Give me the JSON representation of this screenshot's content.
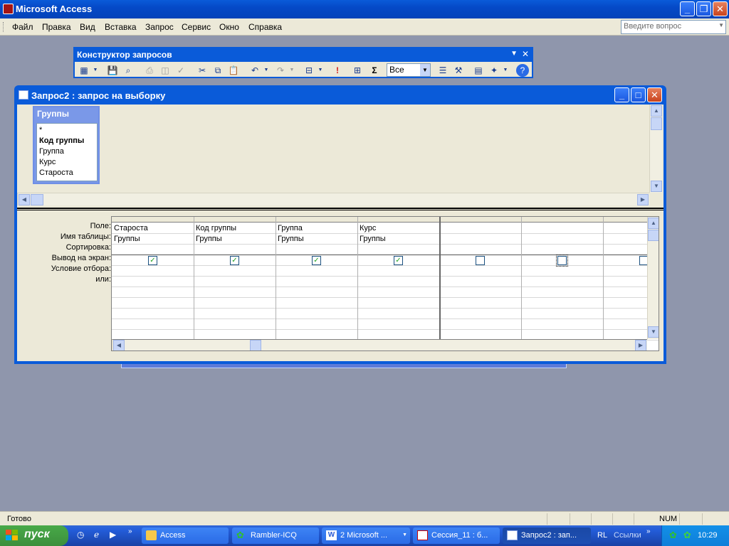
{
  "app": {
    "title": "Microsoft Access"
  },
  "menu": [
    "Файл",
    "Правка",
    "Вид",
    "Вставка",
    "Запрос",
    "Сервис",
    "Окно",
    "Справка"
  ],
  "help_box": {
    "placeholder": "Введите вопрос"
  },
  "toolbar": {
    "title": "Конструктор запросов",
    "top_values": "Все",
    "sigma_label": "Σ",
    "run_icon": "exclamation-icon"
  },
  "query_window": {
    "title": "Запрос2 : запрос на выборку",
    "table": {
      "name": "Группы",
      "fields": [
        "*",
        "Код группы",
        "Группа",
        "Курс",
        "Староста"
      ],
      "primary_key": "Код группы"
    },
    "row_labels": [
      "Поле:",
      "Имя таблицы:",
      "Сортировка:",
      "Вывод на экран:",
      "Условие отбора:",
      "или:"
    ],
    "columns": [
      {
        "field": "Староста",
        "table": "Группы",
        "show": true
      },
      {
        "field": "Код группы",
        "table": "Группы",
        "show": true
      },
      {
        "field": "Группа",
        "table": "Группы",
        "show": true
      },
      {
        "field": "Курс",
        "table": "Группы",
        "show": true
      },
      {
        "field": "",
        "table": "",
        "show": false
      },
      {
        "field": "",
        "table": "",
        "show": false
      },
      {
        "field": "",
        "table": "",
        "show": false
      }
    ]
  },
  "status": {
    "text": "Готово",
    "num": "NUM"
  },
  "taskbar": {
    "start": "пуск",
    "tasks": [
      "Access",
      "Rambler-ICQ",
      "2 Microsoft ...",
      "Сессия_11 : б...",
      "Запрос2 : зап..."
    ],
    "lang": "RL",
    "links": "Ссылки",
    "clock": "10:29"
  }
}
